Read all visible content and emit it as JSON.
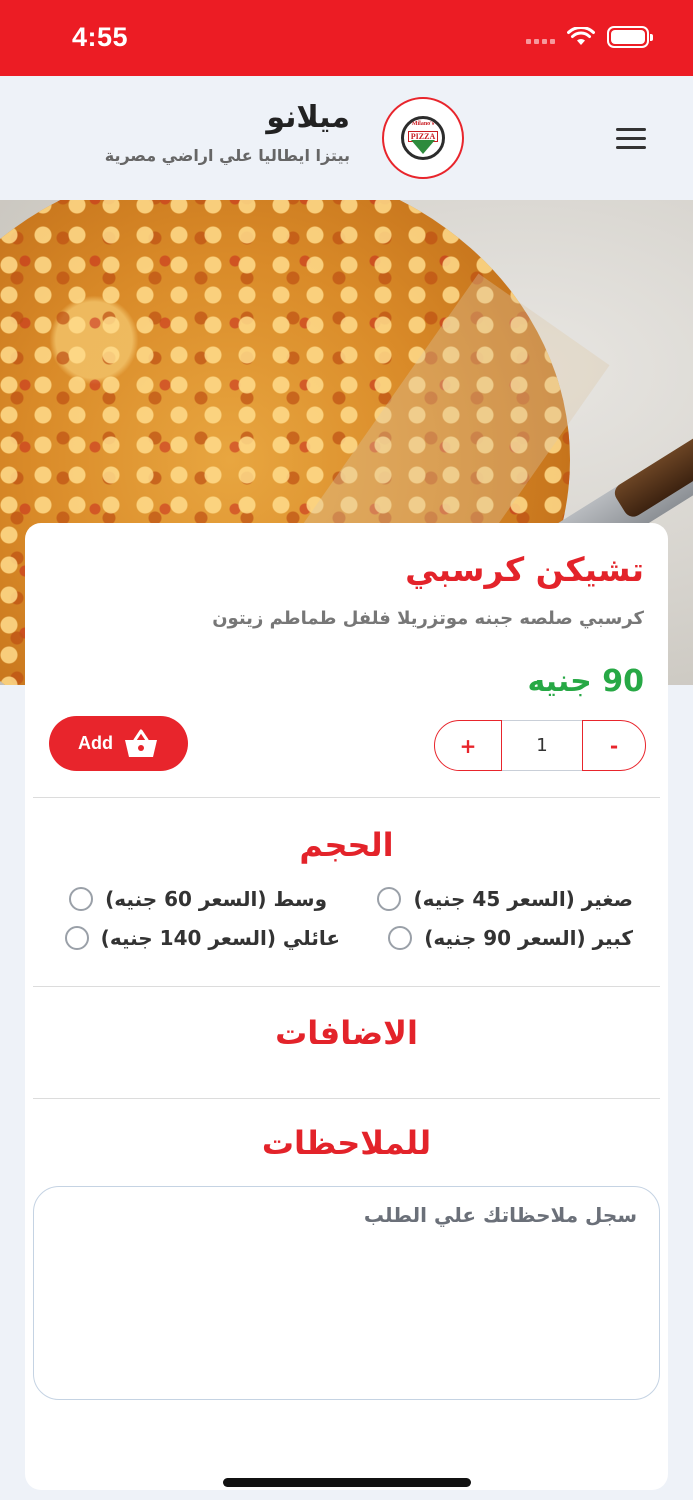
{
  "status": {
    "time": "4:55"
  },
  "header": {
    "brand_name": "ميلانو",
    "brand_tagline": "بيتزا ايطاليا علي اراضي مصرية",
    "logo_text_top": "Milano's",
    "logo_text_main": "PIZZA"
  },
  "product": {
    "title": "تشيكن كرسبي",
    "description": "كرسبي صلصه جبنه موتزريلا فلفل طماطم زيتون",
    "price": "90 جنيه",
    "quantity": "1",
    "plus_label": "+",
    "minus_label": "-",
    "add_label": "Add"
  },
  "size": {
    "title": "الحجم",
    "options": [
      {
        "label": "صغير (السعر 45 جنيه)"
      },
      {
        "label": "وسط (السعر 60 جنيه)"
      },
      {
        "label": "كبير (السعر 90 جنيه)"
      },
      {
        "label": "عائلي (السعر 140 جنيه)"
      }
    ]
  },
  "extras": {
    "title": "الاضافات"
  },
  "notes": {
    "title": "للملاحظات",
    "placeholder": "سجل ملاحظاتك علي الطلب"
  },
  "colors": {
    "accent": "#e8252c",
    "price": "#27a845",
    "statusbar": "#ec1c24"
  }
}
